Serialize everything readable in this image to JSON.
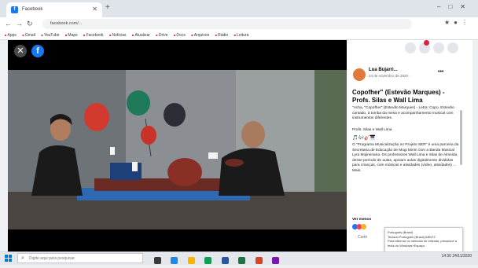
{
  "browser": {
    "tab_title": "Facebook",
    "url": "facebook.com/...",
    "bookmarks": [
      "Apps",
      "Gmail",
      "YouTube",
      "Maps",
      "Facebook",
      "Notícias",
      "Atualizar",
      "Drive",
      "Docs",
      "Arquivos",
      "Rádio",
      "Leitura"
    ]
  },
  "viewer": {
    "close_label": "✕",
    "brand_letter": "f"
  },
  "post": {
    "author": "Lua Bujarri...",
    "date": "24 de novembro de 2020 · ",
    "title": "Copofher\" (Estevão Marques) - Profs. Silas e Wall Lima",
    "line1": "\"Acha, \"Copofher\" (Estevão Marques) - Letra: Copo, Estevão cantado, à tomba da mesa e acompanhamento musical com instrumentos diferentes.",
    "line2": "Profs. Silas e Wall Lima",
    "line3": "O \"Programa Musicalização no Projeto SER\" é uma parceria da Secretaria de Educação de Mogi Mirim com a Banda Musical Lyra Mojimiriana. Os professores Wall Lima e Silas de Almeida, desse período de aulas, apoiam aulas digitalmente divididas para crianças, com músicas e atividades (vídeo, atividades) ... Mais.",
    "see_more": "Ver menos",
    "like_label": "Curtir"
  },
  "notification": {
    "line1": "Português (Brasil)",
    "line2": "Teclado Português (Brasil) ABNT2",
    "line3": "Para alternar os métodos de entrada, pressione a tecla do Windows+Espaço."
  },
  "taskbar": {
    "search_placeholder": "Digite aqui para pesquisar",
    "clock": "14:30 24/11/2020"
  },
  "colors": {
    "facebook_blue": "#1877f2",
    "balloon_red": "#d23a30",
    "balloon_green": "#1f7a5c",
    "balloon_dark": "#2d2d38"
  }
}
